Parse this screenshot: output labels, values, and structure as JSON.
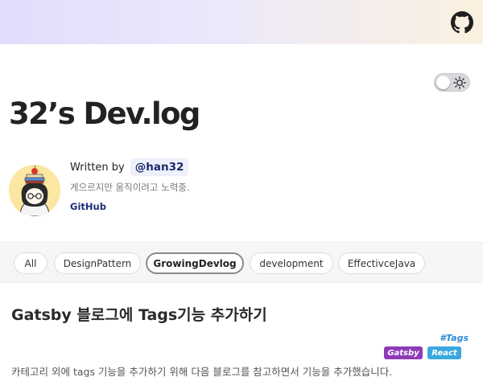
{
  "header": {
    "github_icon": "github-icon",
    "background_from": "#e2dcfb",
    "background_to": "#faf1df"
  },
  "theme_toggle": {
    "icon": "sun-icon",
    "state": "light"
  },
  "site": {
    "title": "32’s Dev.log"
  },
  "profile": {
    "written_by": "Written by",
    "author": "@han32",
    "bio": "게으르지만 움직이려고 노력중.",
    "link": "GitHub"
  },
  "tags": {
    "items": [
      "All",
      "DesignPattern",
      "GrowingDevlog",
      "development",
      "EffectivceJava"
    ],
    "active": "GrowingDevlog"
  },
  "post": {
    "title": "Gatsby 블로그에 Tags기능 추가하기",
    "tags_label": "#Tags",
    "badges": [
      {
        "label": "Gatsby",
        "color": "#8e3bb8"
      },
      {
        "label": "React",
        "color": "#3aa8de"
      }
    ],
    "excerpt": "카테고리 외에 tags 기능을 추가하기 위해 다음 블로그를 참고하면서 기능을 추가했습니다."
  }
}
